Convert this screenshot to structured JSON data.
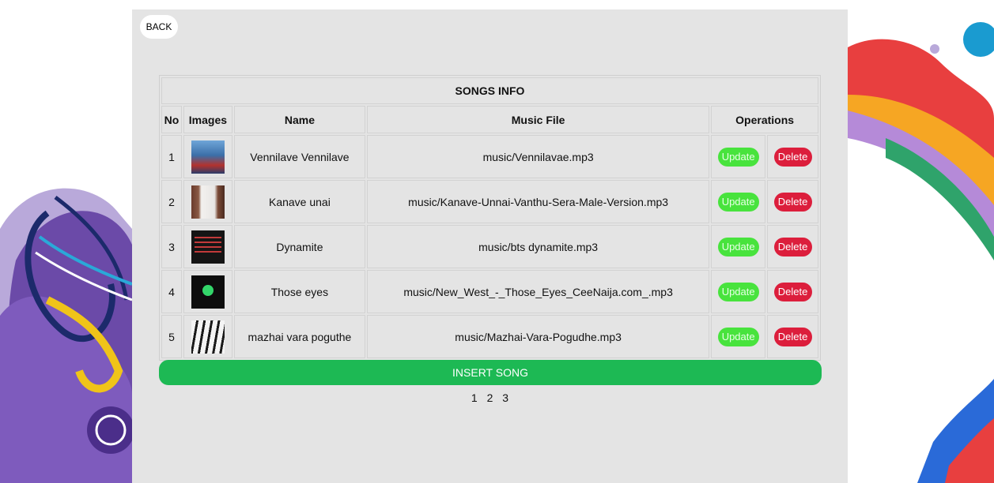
{
  "back_label": "BACK",
  "table": {
    "title": "SONGS INFO",
    "headers": {
      "no": "No",
      "images": "Images",
      "name": "Name",
      "file": "Music File",
      "operations": "Operations"
    },
    "rows": [
      {
        "no": "1",
        "name": "Vennilave Vennilave",
        "file": "music/Vennilavae.mp3",
        "update": "Update",
        "delete": "Delete"
      },
      {
        "no": "2",
        "name": "Kanave unai",
        "file": "music/Kanave-Unnai-Vanthu-Sera-Male-Version.mp3",
        "update": "Update",
        "delete": "Delete"
      },
      {
        "no": "3",
        "name": "Dynamite",
        "file": "music/bts dynamite.mp3",
        "update": "Update",
        "delete": "Delete"
      },
      {
        "no": "4",
        "name": "Those eyes",
        "file": "music/New_West_-_Those_Eyes_CeeNaija.com_.mp3",
        "update": "Update",
        "delete": "Delete"
      },
      {
        "no": "5",
        "name": "mazhai vara poguthe",
        "file": "music/Mazhai-Vara-Pogudhe.mp3",
        "update": "Update",
        "delete": "Delete"
      }
    ]
  },
  "insert_label": "INSERT SONG",
  "pagination": [
    "1",
    "2",
    "3"
  ],
  "colors": {
    "panel": "#e4e4e4",
    "update": "#48e33d",
    "delete": "#dc1e3c",
    "insert": "#1db954"
  }
}
